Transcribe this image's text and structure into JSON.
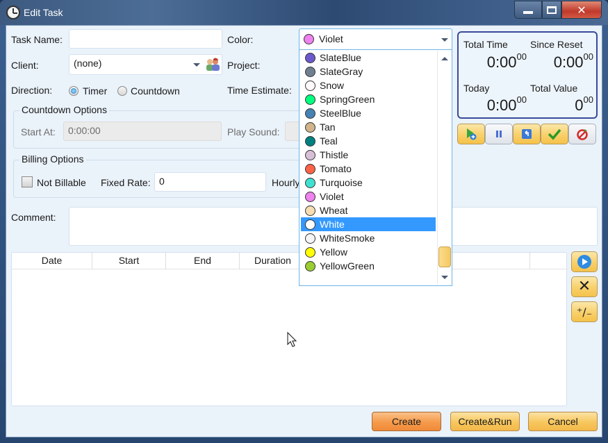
{
  "window": {
    "title": "Edit Task",
    "icon": "clock-icon"
  },
  "caption_buttons": {
    "minimize": "minimize-icon",
    "maximize": "maximize-icon",
    "close": "close-icon"
  },
  "form": {
    "task_name_label": "Task Name:",
    "task_name_value": "",
    "client_label": "Client:",
    "client_value": "(none)",
    "direction_label": "Direction:",
    "direction_options": [
      "Timer",
      "Countdown"
    ],
    "direction_selected": "Timer",
    "color_label": "Color:",
    "project_label": "Project:",
    "time_estimate_label": "Time Estimate:"
  },
  "countdown": {
    "title": "Countdown Options",
    "start_at_label": "Start At:",
    "start_at_value": "0:00:00",
    "play_sound_label": "Play Sound:"
  },
  "billing": {
    "title": "Billing Options",
    "not_billable_label": "Not Billable",
    "not_billable_checked": false,
    "fixed_rate_label": "Fixed Rate:",
    "fixed_rate_value": "0",
    "hourly_label": "Hourly"
  },
  "comment": {
    "label": "Comment:",
    "value": ""
  },
  "color_dropdown": {
    "selected": {
      "name": "Violet",
      "hex": "#ee82ee"
    },
    "highlighted": "White",
    "items": [
      {
        "name": "SlateBlue",
        "hex": "#6a5acd"
      },
      {
        "name": "SlateGray",
        "hex": "#708090"
      },
      {
        "name": "Snow",
        "hex": "#fffafa"
      },
      {
        "name": "SpringGreen",
        "hex": "#00ff7f"
      },
      {
        "name": "SteelBlue",
        "hex": "#4682b4"
      },
      {
        "name": "Tan",
        "hex": "#d2b48c"
      },
      {
        "name": "Teal",
        "hex": "#008080"
      },
      {
        "name": "Thistle",
        "hex": "#d8bfd8"
      },
      {
        "name": "Tomato",
        "hex": "#ff6347"
      },
      {
        "name": "Turquoise",
        "hex": "#40e0d0"
      },
      {
        "name": "Violet",
        "hex": "#ee82ee"
      },
      {
        "name": "Wheat",
        "hex": "#f5deb3"
      },
      {
        "name": "White",
        "hex": "#ffffff"
      },
      {
        "name": "WhiteSmoke",
        "hex": "#f5f5f5"
      },
      {
        "name": "Yellow",
        "hex": "#ffff00"
      },
      {
        "name": "YellowGreen",
        "hex": "#9acd32"
      }
    ]
  },
  "stats": {
    "total_time_label": "Total Time",
    "total_time": "0:00",
    "total_time_sec": "00",
    "since_reset_label": "Since Reset",
    "since_reset": "0:00",
    "since_reset_sec": "00",
    "today_label": "Today",
    "today": "0:00",
    "today_sec": "00",
    "total_value_label": "Total Value",
    "total_value": "0",
    "total_value_cents": "00"
  },
  "timer_buttons": [
    "start-add-icon",
    "pause-icon",
    "reset-icon",
    "complete-check-icon",
    "cancel-timer-icon"
  ],
  "grid": {
    "columns": [
      "Date",
      "Start",
      "End",
      "Duration",
      "",
      ""
    ],
    "rows": []
  },
  "side_buttons": {
    "add": "play-circle-icon",
    "delete": "x-icon",
    "adjust": "plus-minus-icon"
  },
  "footer": {
    "create": "Create",
    "create_run": "Create&Run",
    "cancel": "Cancel"
  }
}
